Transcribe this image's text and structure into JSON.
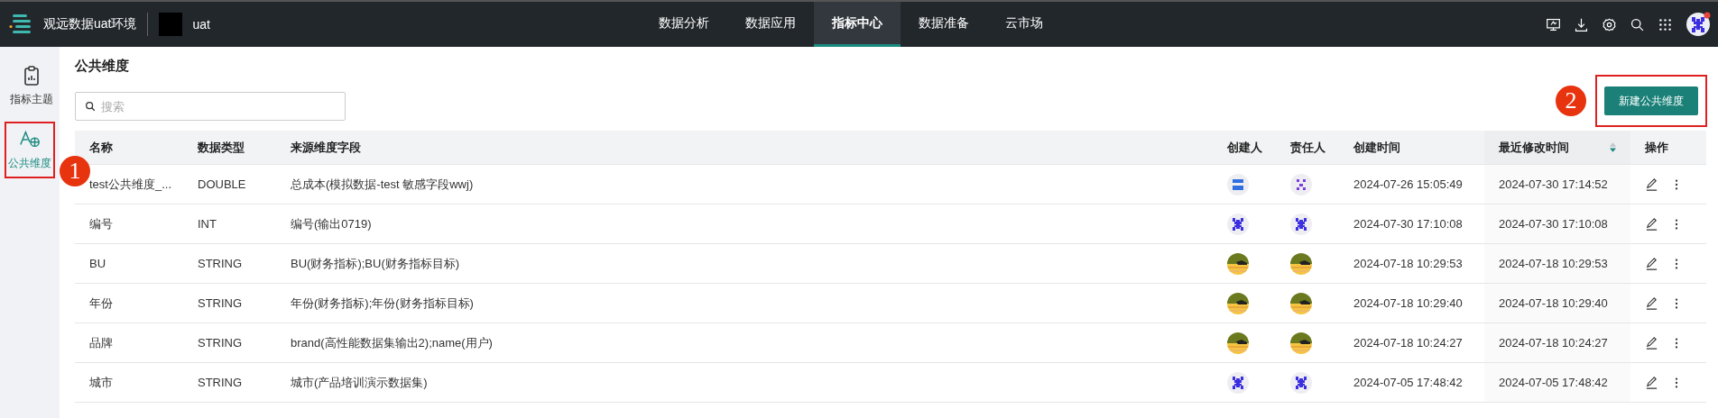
{
  "header": {
    "app_name": "观远数据uat环境",
    "workspace": "uat",
    "nav": [
      {
        "label": "数据分析",
        "selected": false
      },
      {
        "label": "数据应用",
        "selected": false
      },
      {
        "label": "指标中心",
        "selected": true
      },
      {
        "label": "数据准备",
        "selected": false
      },
      {
        "label": "云市场",
        "selected": false
      }
    ],
    "user": {
      "has_notification": true
    }
  },
  "sidebar": {
    "items": [
      {
        "label": "指标主题",
        "kind": "clipboard",
        "selected": false,
        "highlighted": false
      },
      {
        "label": "公共维度",
        "kind": "dimension",
        "selected": true,
        "highlighted": true
      }
    ]
  },
  "page": {
    "title": "公共维度",
    "search": {
      "placeholder": "搜索"
    },
    "create_button": {
      "label": "新建公共维度",
      "highlighted": true
    }
  },
  "annotations": [
    {
      "label": "1"
    },
    {
      "label": "2"
    }
  ],
  "table": {
    "columns": [
      {
        "label": "名称"
      },
      {
        "label": "数据类型"
      },
      {
        "label": "来源维度字段"
      },
      {
        "label": "创建人"
      },
      {
        "label": "责任人"
      },
      {
        "label": "创建时间"
      },
      {
        "label": "最近修改时间",
        "sortable": true
      },
      {
        "label": "操作"
      }
    ],
    "rows": [
      {
        "name": "test公共维度_...",
        "type": "DOUBLE",
        "source": "总成本(模拟数据-test 敏感字段wwj)",
        "creator": {
          "kind": "bars"
        },
        "owner": {
          "kind": "dots"
        },
        "created": "2024-07-26 15:05:49",
        "modified": "2024-07-30 17:14:52"
      },
      {
        "name": "编号",
        "type": "INT",
        "source": "编号(输出0719)",
        "creator": {
          "kind": "glyph"
        },
        "owner": {
          "kind": "glyph"
        },
        "created": "2024-07-30 17:10:08",
        "modified": "2024-07-30 17:10:08"
      },
      {
        "name": "BU",
        "type": "STRING",
        "source": "BU(财务指标);BU(财务指标目标)",
        "created": "2024-07-18 10:29:53",
        "modified": "2024-07-18 10:29:53"
      },
      {
        "name": "年份",
        "type": "STRING",
        "source": "年份(财务指标);年份(财务指标目标)",
        "created": "2024-07-18 10:29:40",
        "modified": "2024-07-18 10:29:40"
      },
      {
        "name": "品牌",
        "type": "STRING",
        "source": "brand(高性能数据集输出2);name(用户)",
        "created": "2024-07-18 10:24:27",
        "modified": "2024-07-18 10:24:27"
      },
      {
        "name": "城市",
        "type": "STRING",
        "source": "城市(产品培训演示数据集)",
        "creator": {
          "kind": "glyph"
        },
        "owner": {
          "kind": "glyph"
        },
        "created": "2024-07-05 17:48:42",
        "modified": "2024-07-05 17:48:42"
      }
    ]
  }
}
